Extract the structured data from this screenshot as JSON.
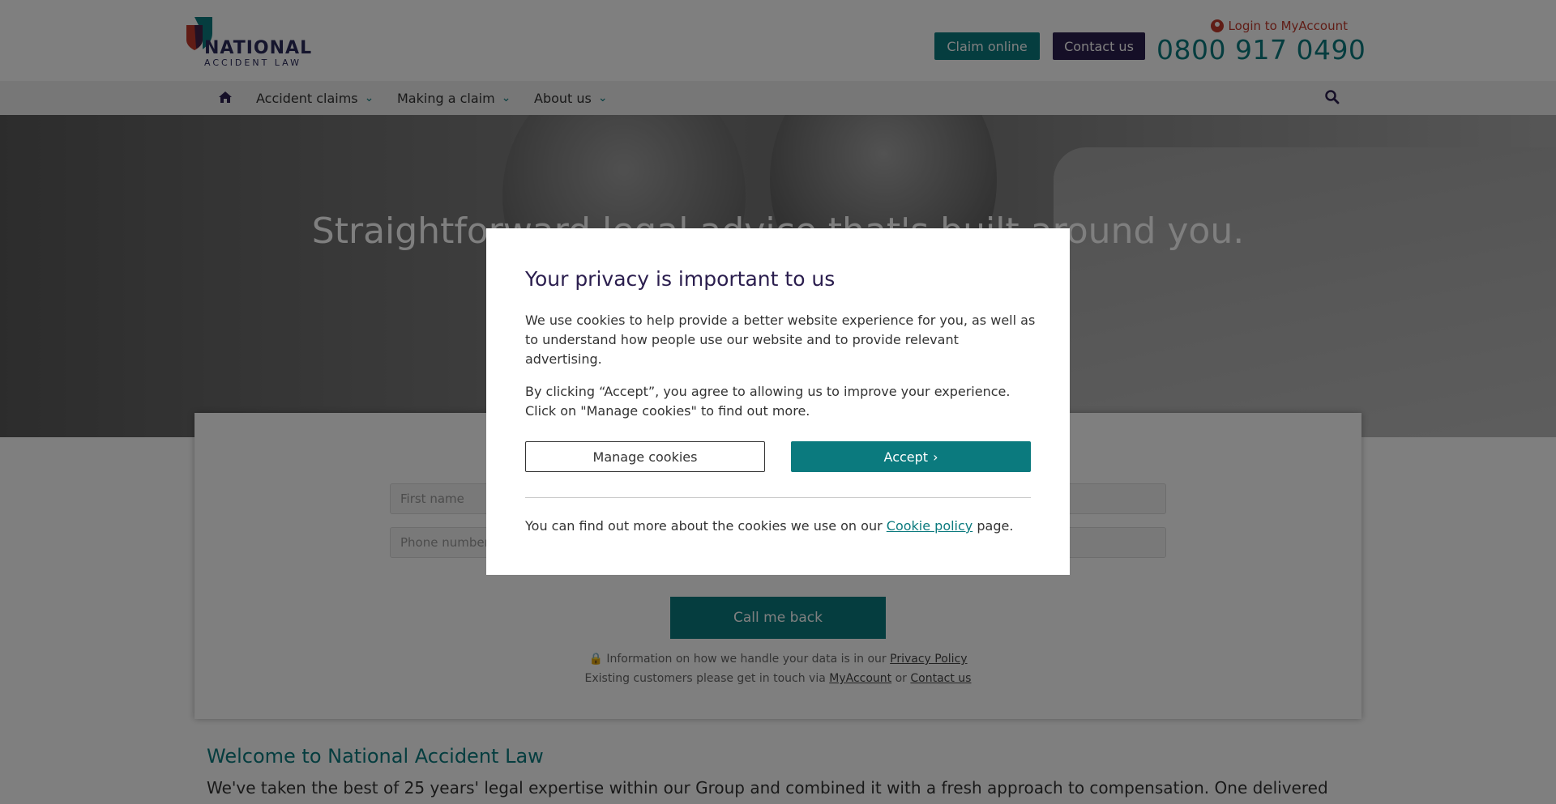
{
  "header": {
    "logo_line1": "NATIONAL",
    "logo_line2": "ACCIDENT LAW",
    "login_label": "Login to MyAccount",
    "claim_button": "Claim online",
    "contact_button": "Contact us",
    "phone": "0800 917 0490"
  },
  "nav": {
    "items": [
      {
        "label": "Accident claims"
      },
      {
        "label": "Making a claim"
      },
      {
        "label": "About us"
      }
    ],
    "home_icon": "home-icon",
    "search_icon": "search-icon"
  },
  "hero": {
    "title": "Straightforward legal advice that's built around you."
  },
  "form": {
    "first_name_placeholder": "First name",
    "phone_placeholder": "Phone number",
    "callback_button": "Call me back",
    "privacy_text": "Information on how we handle your data is in our",
    "privacy_link": "Privacy Policy",
    "existing_text": "Existing customers please get in touch via",
    "myaccount_link": "MyAccount",
    "or_text": "or",
    "contact_link": "Contact us"
  },
  "welcome": {
    "title": "Welcome to National Accident Law",
    "text": "We've taken the best of 25 years' legal expertise within our Group and combined it with a fresh approach to compensation. One delivered"
  },
  "cookie_modal": {
    "title": "Your privacy is important to us",
    "paragraph1": "We use cookies to help provide a better website experience for you, as well as to understand how people use our website and to provide relevant advertising.",
    "paragraph2": "By clicking “Accept”, you agree to allowing us to improve your experience. Click on \"Manage cookies\" to find out more.",
    "manage_button": "Manage cookies",
    "accept_button": "Accept",
    "footer_prefix": "You can find out more about the cookies we use on our",
    "footer_link": "Cookie policy",
    "footer_suffix": "page."
  },
  "colors": {
    "teal": "#0b7a7e",
    "purple": "#2b1e4e",
    "red": "#c0392b"
  }
}
